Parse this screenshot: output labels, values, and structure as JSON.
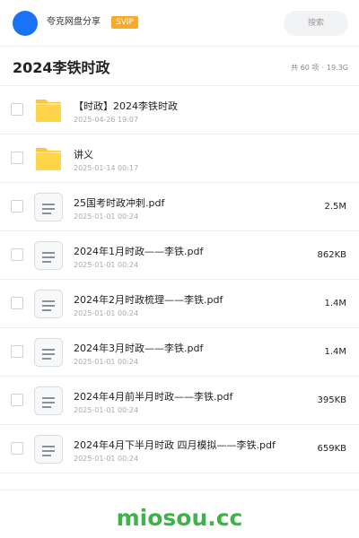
{
  "header": {
    "username": "夸克网盘分享",
    "badge": "SVIP",
    "search_placeholder": "搜索",
    "accent_color": "#1a73f5",
    "badge_color": "#f7a928"
  },
  "folder": {
    "title": "2024李铁时政",
    "count_text": "共 60 项",
    "separator": "·",
    "size_text": "19.3G"
  },
  "files": [
    {
      "type": "folder",
      "name": "【时政】2024李铁时政",
      "date": "2025-04-26 19:07",
      "size": ""
    },
    {
      "type": "folder",
      "name": "讲义",
      "date": "2025-01-14 00:17",
      "size": ""
    },
    {
      "type": "pdf",
      "name": "25国考时政冲刺.pdf",
      "date": "2025-01-01 00:24",
      "size": "2.5M"
    },
    {
      "type": "pdf",
      "name": "2024年1月时政——李铁.pdf",
      "date": "2025-01-01 00:24",
      "size": "862KB"
    },
    {
      "type": "pdf",
      "name": "2024年2月时政梳理——李铁.pdf",
      "date": "2025-01-01 00:24",
      "size": "1.4M"
    },
    {
      "type": "pdf",
      "name": "2024年3月时政——李铁.pdf",
      "date": "2025-01-01 00:24",
      "size": "1.4M"
    },
    {
      "type": "pdf",
      "name": "2024年4月前半月时政——李铁.pdf",
      "date": "2025-01-01 00:24",
      "size": "395KB"
    },
    {
      "type": "pdf",
      "name": "2024年4月下半月时政 四月模拟——李铁.pdf",
      "date": "2025-01-01 00:24",
      "size": "659KB"
    }
  ],
  "watermark": "miosou.cc"
}
